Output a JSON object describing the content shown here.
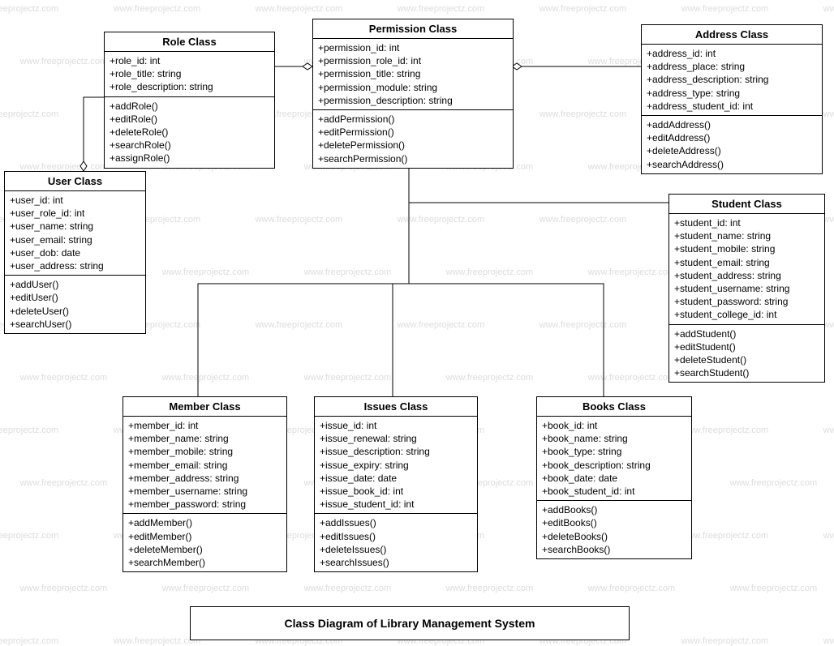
{
  "diagram_title": "Class Diagram of Library Management System",
  "watermark_text": "www.freeprojectz.com",
  "classes": {
    "role": {
      "title": "Role Class",
      "attrs": [
        "+role_id: int",
        "+role_title: string",
        "+role_description: string"
      ],
      "methods": [
        "+addRole()",
        "+editRole()",
        "+deleteRole()",
        "+searchRole()",
        "+assignRole()"
      ]
    },
    "permission": {
      "title": "Permission Class",
      "attrs": [
        "+permission_id: int",
        "+permission_role_id: int",
        "+permission_title: string",
        "+permission_module: string",
        "+permission_description: string"
      ],
      "methods": [
        "+addPermission()",
        "+editPermission()",
        "+deletePermission()",
        "+searchPermission()"
      ]
    },
    "address": {
      "title": "Address Class",
      "attrs": [
        "+address_id: int",
        "+address_place: string",
        "+address_description: string",
        "+address_type: string",
        "+address_student_id: int"
      ],
      "methods": [
        "+addAddress()",
        "+editAddress()",
        "+deleteAddress()",
        "+searchAddress()"
      ]
    },
    "user": {
      "title": "User Class",
      "attrs": [
        "+user_id: int",
        "+user_role_id: int",
        "+user_name: string",
        "+user_email: string",
        "+user_dob: date",
        "+user_address: string"
      ],
      "methods": [
        "+addUser()",
        "+editUser()",
        "+deleteUser()",
        "+searchUser()"
      ]
    },
    "student": {
      "title": "Student Class",
      "attrs": [
        "+student_id: int",
        "+student_name: string",
        "+student_mobile: string",
        "+student_email: string",
        "+student_address: string",
        "+student_username: string",
        "+student_password: string",
        "+student_college_id: int"
      ],
      "methods": [
        "+addStudent()",
        "+editStudent()",
        "+deleteStudent()",
        "+searchStudent()"
      ]
    },
    "member": {
      "title": "Member Class",
      "attrs": [
        "+member_id: int",
        "+member_name: string",
        "+member_mobile: string",
        "+member_email: string",
        "+member_address: string",
        "+member_username: string",
        "+member_password: string"
      ],
      "methods": [
        "+addMember()",
        "+editMember()",
        "+deleteMember()",
        "+searchMember()"
      ]
    },
    "issues": {
      "title": "Issues Class",
      "attrs": [
        "+issue_id: int",
        "+issue_renewal: string",
        "+issue_description: string",
        "+issue_expiry: string",
        "+issue_date: date",
        "+issue_book_id: int",
        "+issue_student_id: int"
      ],
      "methods": [
        "+addIssues()",
        "+editIssues()",
        "+deleteIssues()",
        "+searchIssues()"
      ]
    },
    "books": {
      "title": "Books Class",
      "attrs": [
        "+book_id: int",
        "+book_name: string",
        "+book_type: string",
        "+book_description: string",
        "+book_date: date",
        "+book_student_id: int"
      ],
      "methods": [
        "+addBooks()",
        "+editBooks()",
        "+deleteBooks()",
        "+searchBooks()"
      ]
    }
  }
}
